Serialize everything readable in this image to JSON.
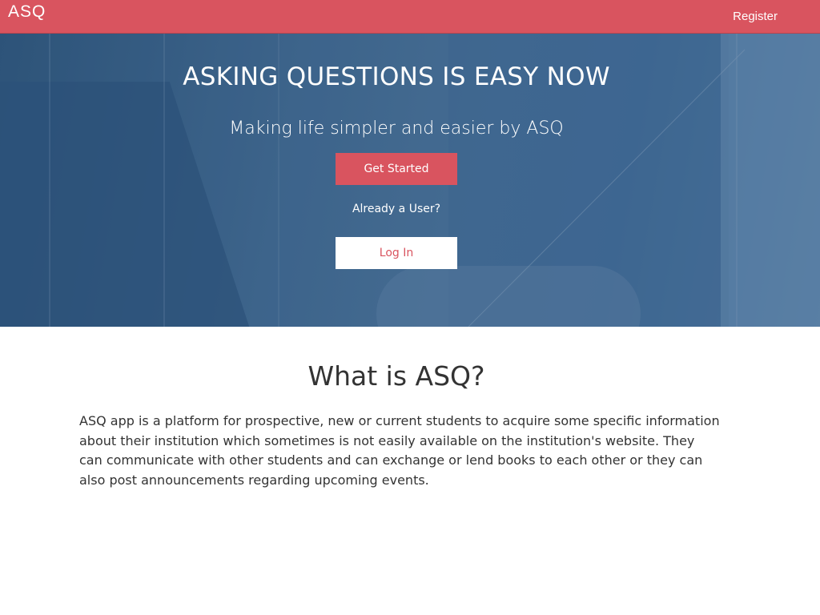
{
  "navbar": {
    "logo_text": "ASQ",
    "register_label": "Register",
    "background_color": "#d9545f"
  },
  "hero": {
    "title": "ASKING QUESTIONS IS EASY NOW",
    "subtitle": "Making life simpler and easier by ASQ",
    "get_started_label": "Get Started",
    "already_user_text": "Already a User?",
    "login_label": "Log In",
    "accent_color": "#d9545f",
    "overlay_color": "#46709a"
  },
  "about": {
    "heading": "What is ASQ?",
    "description": "ASQ app is a platform for prospective, new or current students to acquire some specific information about their institution which sometimes is not easily available on the institution's website. They can communicate with other students and can exchange or lend books to each other or they can also post announcements regarding upcoming events."
  }
}
